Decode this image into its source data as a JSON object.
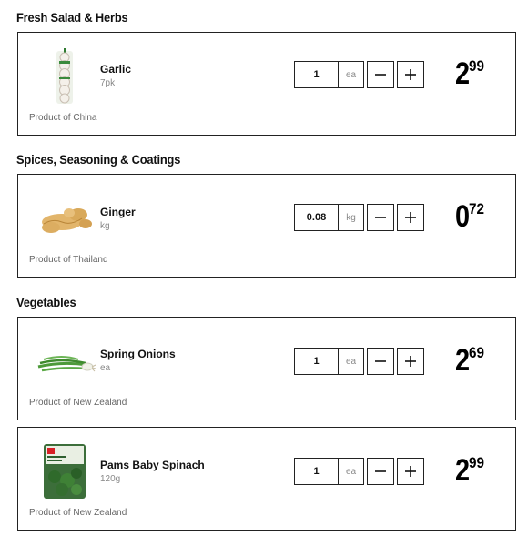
{
  "sections": [
    {
      "title": "Fresh Salad & Herbs",
      "products": [
        {
          "name": "Garlic",
          "unit": "7pk",
          "origin": "Product of China",
          "quantity": "1",
          "uom": "ea",
          "price_dollars": "2",
          "price_cents": "99",
          "image_icon": "garlic-icon"
        }
      ]
    },
    {
      "title": "Spices, Seasoning & Coatings",
      "products": [
        {
          "name": "Ginger",
          "unit": "kg",
          "origin": "Product of Thailand",
          "quantity": "0.08",
          "uom": "kg",
          "price_dollars": "0",
          "price_cents": "72",
          "image_icon": "ginger-icon"
        }
      ]
    },
    {
      "title": "Vegetables",
      "products": [
        {
          "name": "Spring Onions",
          "unit": "ea",
          "origin": "Product of New Zealand",
          "quantity": "1",
          "uom": "ea",
          "price_dollars": "2",
          "price_cents": "69",
          "image_icon": "spring-onion-icon"
        },
        {
          "name": "Pams Baby Spinach",
          "unit": "120g",
          "origin": "Product of New Zealand",
          "quantity": "1",
          "uom": "ea",
          "price_dollars": "2",
          "price_cents": "99",
          "image_icon": "spinach-bag-icon"
        }
      ]
    }
  ],
  "controls": {
    "decrease_icon": "minus-icon",
    "increase_icon": "plus-icon"
  },
  "colors": {
    "border": "#222222",
    "muted_text": "#888888",
    "price": "#000000"
  }
}
